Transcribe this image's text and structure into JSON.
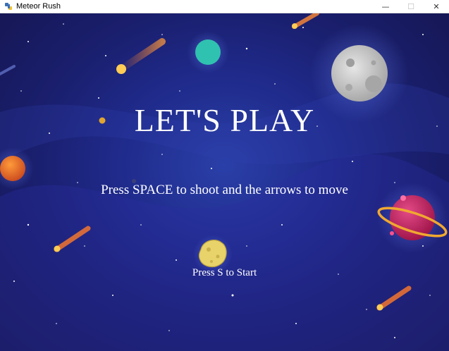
{
  "window": {
    "title": "Meteor Rush",
    "minimize_glyph": "—",
    "maximize_glyph": "☐",
    "close_glyph": "✕"
  },
  "game": {
    "heading": "LET'S PLAY",
    "instructions": "Press SPACE to shoot and the arrows to move",
    "start_prompt": "Press S to Start"
  },
  "colors": {
    "background_center": "#2a3fa8",
    "background_edge": "#15154f",
    "text": "#ffffff",
    "teal_planet": "#2fc2b0",
    "orange_planet": "#e8722a",
    "magenta_planet": "#c2185b",
    "ring": "#f0a830",
    "moon": "#c8c8c8",
    "asteroid": "#e8d36a"
  },
  "icons": [
    "snake-app-icon",
    "minimize-icon",
    "maximize-icon",
    "close-icon"
  ]
}
